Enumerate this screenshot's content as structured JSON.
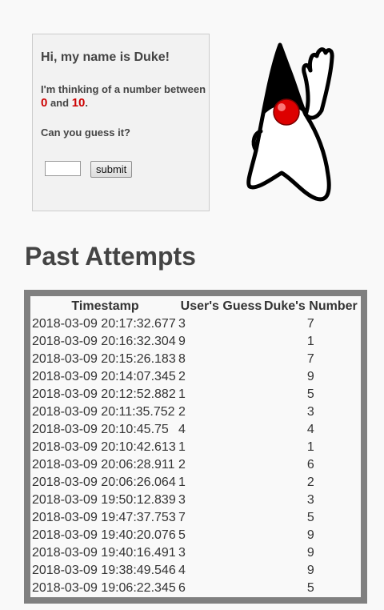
{
  "guess_card": {
    "title": "Hi, my name is Duke!",
    "text_prefix": "I'm thinking of a number between ",
    "min_number": "0",
    "text_and": " and ",
    "max_number": "10",
    "text_suffix": ".",
    "question": "Can you guess it?",
    "guess_value": "",
    "submit_label": "submit"
  },
  "mascot": {
    "icon": "duke-mascot-icon"
  },
  "past_attempts": {
    "title": "Past Attempts",
    "columns": [
      "Timestamp",
      "User's Guess",
      "Duke's Number"
    ],
    "rows": [
      [
        "2018-03-09 20:17:32.677",
        "3",
        "7"
      ],
      [
        "2018-03-09 20:16:32.304",
        "9",
        "1"
      ],
      [
        "2018-03-09 20:15:26.183",
        "8",
        "7"
      ],
      [
        "2018-03-09 20:14:07.345",
        "2",
        "9"
      ],
      [
        "2018-03-09 20:12:52.882",
        "1",
        "5"
      ],
      [
        "2018-03-09 20:11:35.752",
        "2",
        "3"
      ],
      [
        "2018-03-09 20:10:45.75",
        "4",
        "4"
      ],
      [
        "2018-03-09 20:10:42.613",
        "1",
        "1"
      ],
      [
        "2018-03-09 20:06:28.911",
        "2",
        "6"
      ],
      [
        "2018-03-09 20:06:26.064",
        "1",
        "2"
      ],
      [
        "2018-03-09 19:50:12.839",
        "3",
        "3"
      ],
      [
        "2018-03-09 19:47:37.753",
        "7",
        "5"
      ],
      [
        "2018-03-09 19:40:20.076",
        "5",
        "9"
      ],
      [
        "2018-03-09 19:40:16.491",
        "3",
        "9"
      ],
      [
        "2018-03-09 19:38:49.546",
        "4",
        "9"
      ],
      [
        "2018-03-09 19:06:22.345",
        "6",
        "5"
      ]
    ]
  },
  "colors": {
    "accent": "#cc0000",
    "table_border": "#808080"
  }
}
